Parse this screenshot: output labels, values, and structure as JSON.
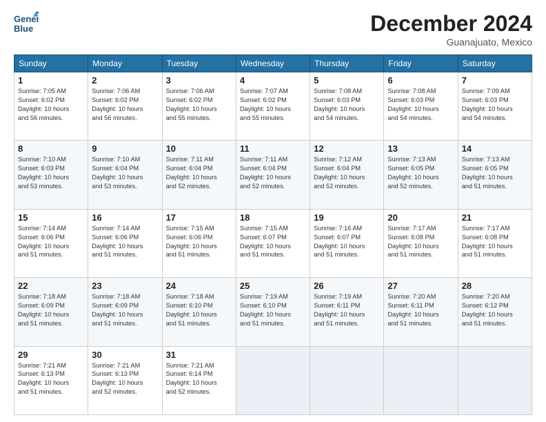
{
  "logo": {
    "line1": "General",
    "line2": "Blue"
  },
  "title": "December 2024",
  "subtitle": "Guanajuato, Mexico",
  "days_of_week": [
    "Sunday",
    "Monday",
    "Tuesday",
    "Wednesday",
    "Thursday",
    "Friday",
    "Saturday"
  ],
  "weeks": [
    [
      {
        "day": "1",
        "info": "Sunrise: 7:05 AM\nSunset: 6:02 PM\nDaylight: 10 hours\nand 56 minutes."
      },
      {
        "day": "2",
        "info": "Sunrise: 7:06 AM\nSunset: 6:02 PM\nDaylight: 10 hours\nand 56 minutes."
      },
      {
        "day": "3",
        "info": "Sunrise: 7:06 AM\nSunset: 6:02 PM\nDaylight: 10 hours\nand 55 minutes."
      },
      {
        "day": "4",
        "info": "Sunrise: 7:07 AM\nSunset: 6:02 PM\nDaylight: 10 hours\nand 55 minutes."
      },
      {
        "day": "5",
        "info": "Sunrise: 7:08 AM\nSunset: 6:03 PM\nDaylight: 10 hours\nand 54 minutes."
      },
      {
        "day": "6",
        "info": "Sunrise: 7:08 AM\nSunset: 6:03 PM\nDaylight: 10 hours\nand 54 minutes."
      },
      {
        "day": "7",
        "info": "Sunrise: 7:09 AM\nSunset: 6:03 PM\nDaylight: 10 hours\nand 54 minutes."
      }
    ],
    [
      {
        "day": "8",
        "info": "Sunrise: 7:10 AM\nSunset: 6:03 PM\nDaylight: 10 hours\nand 53 minutes."
      },
      {
        "day": "9",
        "info": "Sunrise: 7:10 AM\nSunset: 6:04 PM\nDaylight: 10 hours\nand 53 minutes."
      },
      {
        "day": "10",
        "info": "Sunrise: 7:11 AM\nSunset: 6:04 PM\nDaylight: 10 hours\nand 52 minutes."
      },
      {
        "day": "11",
        "info": "Sunrise: 7:11 AM\nSunset: 6:04 PM\nDaylight: 10 hours\nand 52 minutes."
      },
      {
        "day": "12",
        "info": "Sunrise: 7:12 AM\nSunset: 6:04 PM\nDaylight: 10 hours\nand 52 minutes."
      },
      {
        "day": "13",
        "info": "Sunrise: 7:13 AM\nSunset: 6:05 PM\nDaylight: 10 hours\nand 52 minutes."
      },
      {
        "day": "14",
        "info": "Sunrise: 7:13 AM\nSunset: 6:05 PM\nDaylight: 10 hours\nand 51 minutes."
      }
    ],
    [
      {
        "day": "15",
        "info": "Sunrise: 7:14 AM\nSunset: 6:06 PM\nDaylight: 10 hours\nand 51 minutes."
      },
      {
        "day": "16",
        "info": "Sunrise: 7:14 AM\nSunset: 6:06 PM\nDaylight: 10 hours\nand 51 minutes."
      },
      {
        "day": "17",
        "info": "Sunrise: 7:15 AM\nSunset: 6:06 PM\nDaylight: 10 hours\nand 51 minutes."
      },
      {
        "day": "18",
        "info": "Sunrise: 7:15 AM\nSunset: 6:07 PM\nDaylight: 10 hours\nand 51 minutes."
      },
      {
        "day": "19",
        "info": "Sunrise: 7:16 AM\nSunset: 6:07 PM\nDaylight: 10 hours\nand 51 minutes."
      },
      {
        "day": "20",
        "info": "Sunrise: 7:17 AM\nSunset: 6:08 PM\nDaylight: 10 hours\nand 51 minutes."
      },
      {
        "day": "21",
        "info": "Sunrise: 7:17 AM\nSunset: 6:08 PM\nDaylight: 10 hours\nand 51 minutes."
      }
    ],
    [
      {
        "day": "22",
        "info": "Sunrise: 7:18 AM\nSunset: 6:09 PM\nDaylight: 10 hours\nand 51 minutes."
      },
      {
        "day": "23",
        "info": "Sunrise: 7:18 AM\nSunset: 6:09 PM\nDaylight: 10 hours\nand 51 minutes."
      },
      {
        "day": "24",
        "info": "Sunrise: 7:18 AM\nSunset: 6:10 PM\nDaylight: 10 hours\nand 51 minutes."
      },
      {
        "day": "25",
        "info": "Sunrise: 7:19 AM\nSunset: 6:10 PM\nDaylight: 10 hours\nand 51 minutes."
      },
      {
        "day": "26",
        "info": "Sunrise: 7:19 AM\nSunset: 6:11 PM\nDaylight: 10 hours\nand 51 minutes."
      },
      {
        "day": "27",
        "info": "Sunrise: 7:20 AM\nSunset: 6:11 PM\nDaylight: 10 hours\nand 51 minutes."
      },
      {
        "day": "28",
        "info": "Sunrise: 7:20 AM\nSunset: 6:12 PM\nDaylight: 10 hours\nand 51 minutes."
      }
    ],
    [
      {
        "day": "29",
        "info": "Sunrise: 7:21 AM\nSunset: 6:13 PM\nDaylight: 10 hours\nand 51 minutes."
      },
      {
        "day": "30",
        "info": "Sunrise: 7:21 AM\nSunset: 6:13 PM\nDaylight: 10 hours\nand 52 minutes."
      },
      {
        "day": "31",
        "info": "Sunrise: 7:21 AM\nSunset: 6:14 PM\nDaylight: 10 hours\nand 52 minutes."
      },
      null,
      null,
      null,
      null
    ]
  ],
  "colors": {
    "header_bg": "#2471a3",
    "header_text": "#ffffff",
    "accent": "#1a5276"
  }
}
